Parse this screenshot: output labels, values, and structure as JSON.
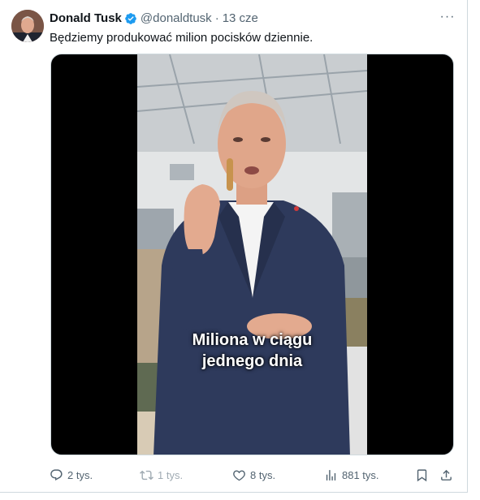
{
  "tweet": {
    "author_name": "Donald Tusk",
    "handle": "@donaldtusk",
    "separator": "·",
    "date": "13 cze",
    "more_label": "···",
    "text": "Będziemy produkować milion pocisków dziennie.",
    "video": {
      "caption_line1": "Miliona w ciągu",
      "caption_line2": "jednego dnia"
    },
    "stats": {
      "replies": "2 tys.",
      "retweets": "1 tys.",
      "likes": "8 tys.",
      "views": "881 tys."
    }
  },
  "colors": {
    "verified": "#1d9bf0",
    "muted_text": "#536471",
    "border": "#cfd9de",
    "suit": "#2e3a5c"
  },
  "icons": [
    "verified-badge-icon",
    "more-icon",
    "reply-icon",
    "retweet-icon",
    "like-icon",
    "views-icon",
    "bookmark-icon",
    "share-icon"
  ]
}
